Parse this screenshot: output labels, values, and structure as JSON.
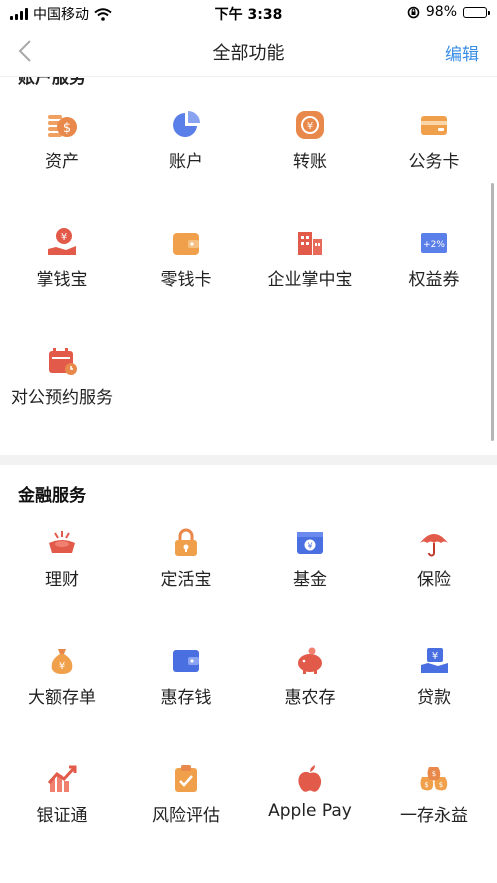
{
  "status_bar": {
    "carrier": "中国移动",
    "time": "下午 3:38",
    "battery": "98%",
    "battery_level": 0.98
  },
  "nav": {
    "title": "全部功能",
    "edit": "编辑"
  },
  "sections": {
    "account": {
      "title": "账户服务",
      "items": [
        {
          "label": "资产",
          "icon": "coins-icon"
        },
        {
          "label": "账户",
          "icon": "pie-chart-icon"
        },
        {
          "label": "转账",
          "icon": "transfer-icon"
        },
        {
          "label": "公务卡",
          "icon": "card-icon"
        },
        {
          "label": "掌钱宝",
          "icon": "hand-coin-icon"
        },
        {
          "label": "零钱卡",
          "icon": "wallet-icon"
        },
        {
          "label": "企业掌中宝",
          "icon": "building-icon"
        },
        {
          "label": "权益券",
          "icon": "coupon-icon"
        },
        {
          "label": "对公预约服务",
          "icon": "calendar-clock-icon"
        }
      ]
    },
    "finance": {
      "title": "金融服务",
      "items": [
        {
          "label": "理财",
          "icon": "gold-ingot-icon"
        },
        {
          "label": "定活宝",
          "icon": "lock-icon"
        },
        {
          "label": "基金",
          "icon": "fund-card-icon"
        },
        {
          "label": "保险",
          "icon": "umbrella-icon"
        },
        {
          "label": "大额存单",
          "icon": "money-bag-icon"
        },
        {
          "label": "惠存钱",
          "icon": "wallet-blue-icon"
        },
        {
          "label": "惠农存",
          "icon": "piggy-bank-icon"
        },
        {
          "label": "贷款",
          "icon": "loan-hand-icon"
        },
        {
          "label": "银证通",
          "icon": "stock-chart-icon"
        },
        {
          "label": "风险评估",
          "icon": "clipboard-check-icon"
        },
        {
          "label": "Apple Pay",
          "icon": "apple-icon"
        },
        {
          "label": "一存永益",
          "icon": "money-bags-icon"
        }
      ]
    }
  }
}
